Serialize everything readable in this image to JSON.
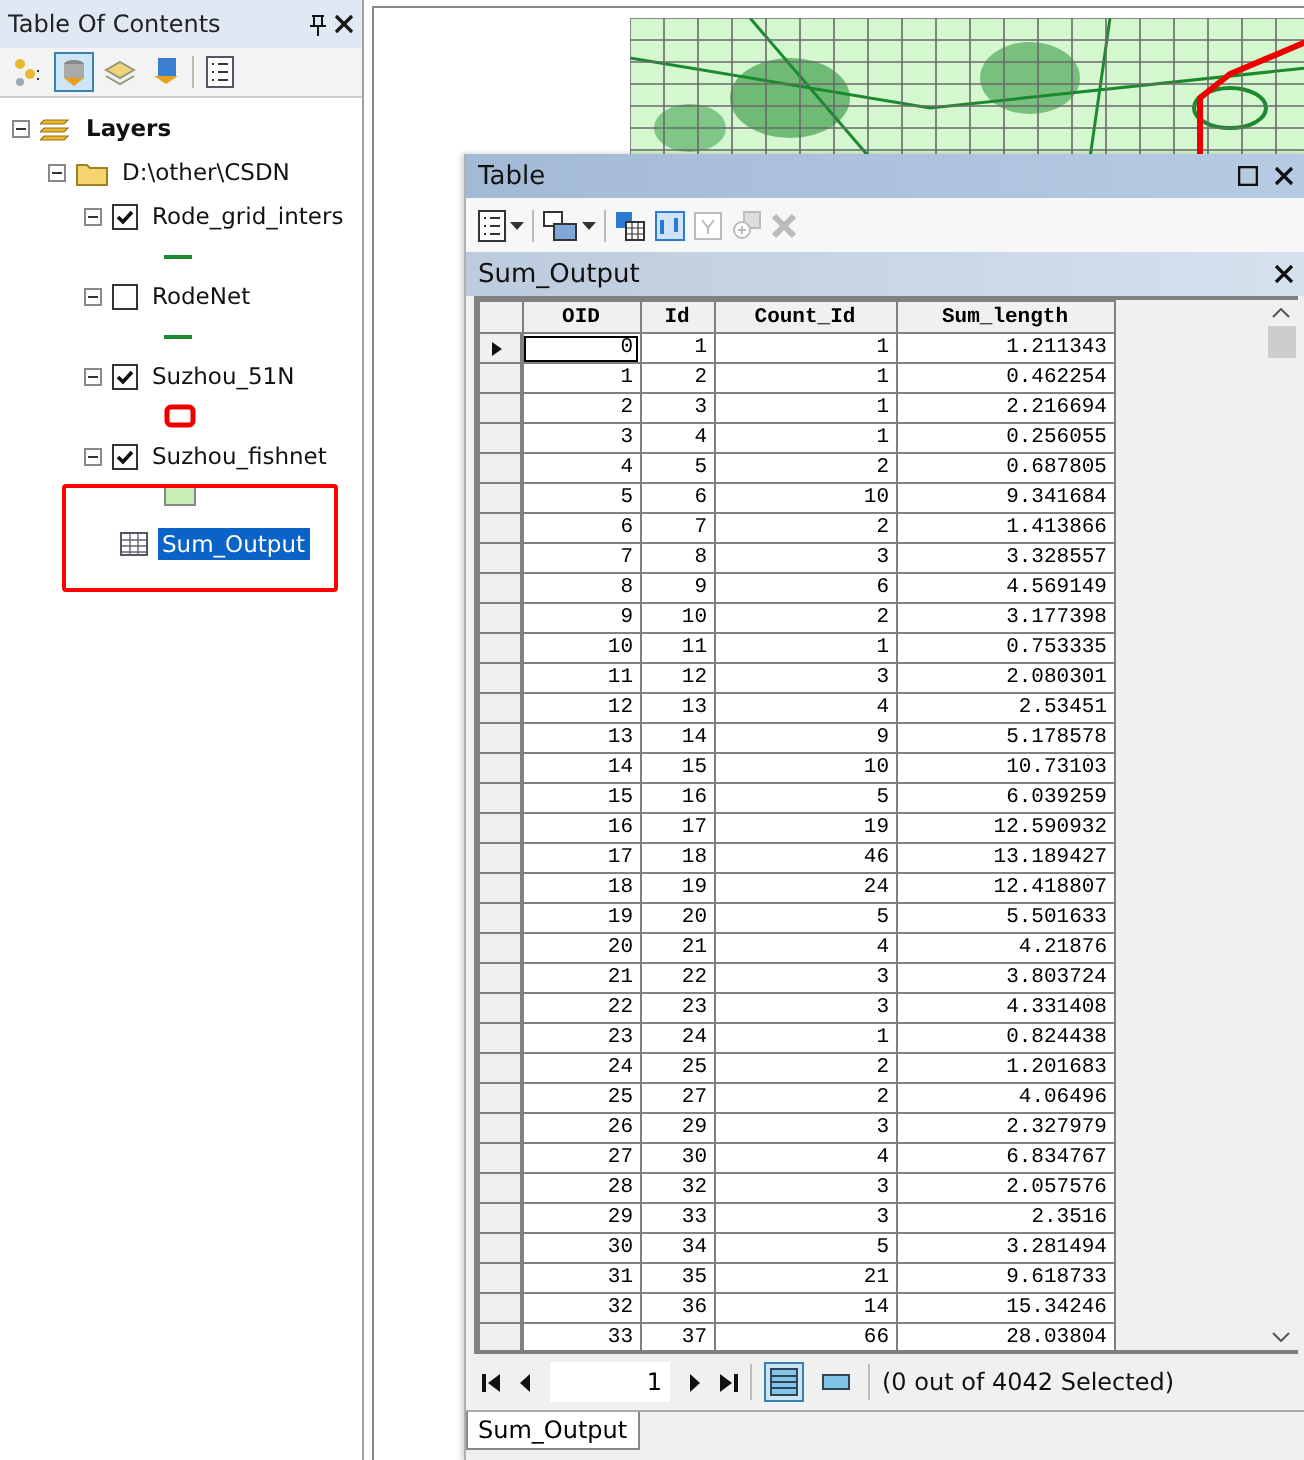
{
  "toc": {
    "title": "Table Of Contents",
    "toolbar": [
      {
        "kind": "drawing-order",
        "selected": false
      },
      {
        "kind": "source",
        "selected": true
      },
      {
        "kind": "visibility",
        "selected": false
      },
      {
        "kind": "selection",
        "selected": false
      },
      {
        "kind": "options",
        "selected": false
      }
    ],
    "tree": {
      "label": "Layers",
      "expanded": true,
      "children": [
        {
          "kind": "folder",
          "label": "D:\\other\\CSDN",
          "expanded": true,
          "children": [
            {
              "kind": "layer",
              "label": "Rode_grid_inters",
              "checked": true,
              "expanded": true,
              "symbol": {
                "kind": "line"
              },
              "selected": false
            },
            {
              "kind": "layer",
              "label": "RodeNet",
              "checked": false,
              "expanded": true,
              "symbol": {
                "kind": "line"
              },
              "selected": false
            },
            {
              "kind": "layer",
              "label": "Suzhou_51N",
              "checked": true,
              "expanded": true,
              "symbol": {
                "kind": "outline"
              },
              "selected": false
            },
            {
              "kind": "layer",
              "label": "Suzhou_fishnet",
              "checked": true,
              "expanded": true,
              "symbol": {
                "kind": "fill"
              },
              "selected": false
            },
            {
              "kind": "table",
              "label": "Sum_Output",
              "selected": true
            }
          ]
        }
      ]
    }
  },
  "table_window": {
    "title": "Table",
    "subtitle": "Sum_Output",
    "toolbar": [
      {
        "kind": "options",
        "disabled": false
      },
      {
        "kind": "related",
        "disabled": false
      },
      {
        "kind": "select-by-attributes",
        "disabled": false
      },
      {
        "kind": "switch-selection",
        "disabled": false
      },
      {
        "kind": "clear-selection",
        "disabled": true
      },
      {
        "kind": "zoom-to-selected",
        "disabled": true
      },
      {
        "kind": "delete",
        "disabled": true
      }
    ],
    "columns": [
      "OID",
      "Id",
      "Count_Id",
      "Sum_length"
    ],
    "rows": [
      {
        "cells": [
          "0",
          "1",
          "1",
          "1.211343"
        ],
        "current": true
      },
      {
        "cells": [
          "1",
          "2",
          "1",
          "0.462254"
        ],
        "current": false
      },
      {
        "cells": [
          "2",
          "3",
          "1",
          "2.216694"
        ],
        "current": false
      },
      {
        "cells": [
          "3",
          "4",
          "1",
          "0.256055"
        ],
        "current": false
      },
      {
        "cells": [
          "4",
          "5",
          "2",
          "0.687805"
        ],
        "current": false
      },
      {
        "cells": [
          "5",
          "6",
          "10",
          "9.341684"
        ],
        "current": false
      },
      {
        "cells": [
          "6",
          "7",
          "2",
          "1.413866"
        ],
        "current": false
      },
      {
        "cells": [
          "7",
          "8",
          "3",
          "3.328557"
        ],
        "current": false
      },
      {
        "cells": [
          "8",
          "9",
          "6",
          "4.569149"
        ],
        "current": false
      },
      {
        "cells": [
          "9",
          "10",
          "2",
          "3.177398"
        ],
        "current": false
      },
      {
        "cells": [
          "10",
          "11",
          "1",
          "0.753335"
        ],
        "current": false
      },
      {
        "cells": [
          "11",
          "12",
          "3",
          "2.080301"
        ],
        "current": false
      },
      {
        "cells": [
          "12",
          "13",
          "4",
          "2.53451"
        ],
        "current": false
      },
      {
        "cells": [
          "13",
          "14",
          "9",
          "5.178578"
        ],
        "current": false
      },
      {
        "cells": [
          "14",
          "15",
          "10",
          "10.73103"
        ],
        "current": false
      },
      {
        "cells": [
          "15",
          "16",
          "5",
          "6.039259"
        ],
        "current": false
      },
      {
        "cells": [
          "16",
          "17",
          "19",
          "12.590932"
        ],
        "current": false
      },
      {
        "cells": [
          "17",
          "18",
          "46",
          "13.189427"
        ],
        "current": false
      },
      {
        "cells": [
          "18",
          "19",
          "24",
          "12.418807"
        ],
        "current": false
      },
      {
        "cells": [
          "19",
          "20",
          "5",
          "5.501633"
        ],
        "current": false
      },
      {
        "cells": [
          "20",
          "21",
          "4",
          "4.21876"
        ],
        "current": false
      },
      {
        "cells": [
          "21",
          "22",
          "3",
          "3.803724"
        ],
        "current": false
      },
      {
        "cells": [
          "22",
          "23",
          "3",
          "4.331408"
        ],
        "current": false
      },
      {
        "cells": [
          "23",
          "24",
          "1",
          "0.824438"
        ],
        "current": false
      },
      {
        "cells": [
          "24",
          "25",
          "2",
          "1.201683"
        ],
        "current": false
      },
      {
        "cells": [
          "25",
          "27",
          "2",
          "4.06496"
        ],
        "current": false
      },
      {
        "cells": [
          "26",
          "29",
          "3",
          "2.327979"
        ],
        "current": false
      },
      {
        "cells": [
          "27",
          "30",
          "4",
          "6.834767"
        ],
        "current": false
      },
      {
        "cells": [
          "28",
          "32",
          "3",
          "2.057576"
        ],
        "current": false
      },
      {
        "cells": [
          "29",
          "33",
          "3",
          "2.3516"
        ],
        "current": false
      },
      {
        "cells": [
          "30",
          "34",
          "5",
          "3.281494"
        ],
        "current": false
      },
      {
        "cells": [
          "31",
          "35",
          "21",
          "9.618733"
        ],
        "current": false
      },
      {
        "cells": [
          "32",
          "36",
          "14",
          "15.34246"
        ],
        "current": false
      },
      {
        "cells": [
          "33",
          "37",
          "66",
          "28.03804"
        ],
        "current": false
      }
    ],
    "navigation": {
      "page": "1",
      "views": [
        {
          "kind": "all",
          "selected": true
        },
        {
          "kind": "selected",
          "selected": false
        }
      ],
      "status": "(0 out of 4042 Selected)"
    },
    "tabs": [
      {
        "label": "Sum_Output",
        "selected": true
      }
    ]
  }
}
